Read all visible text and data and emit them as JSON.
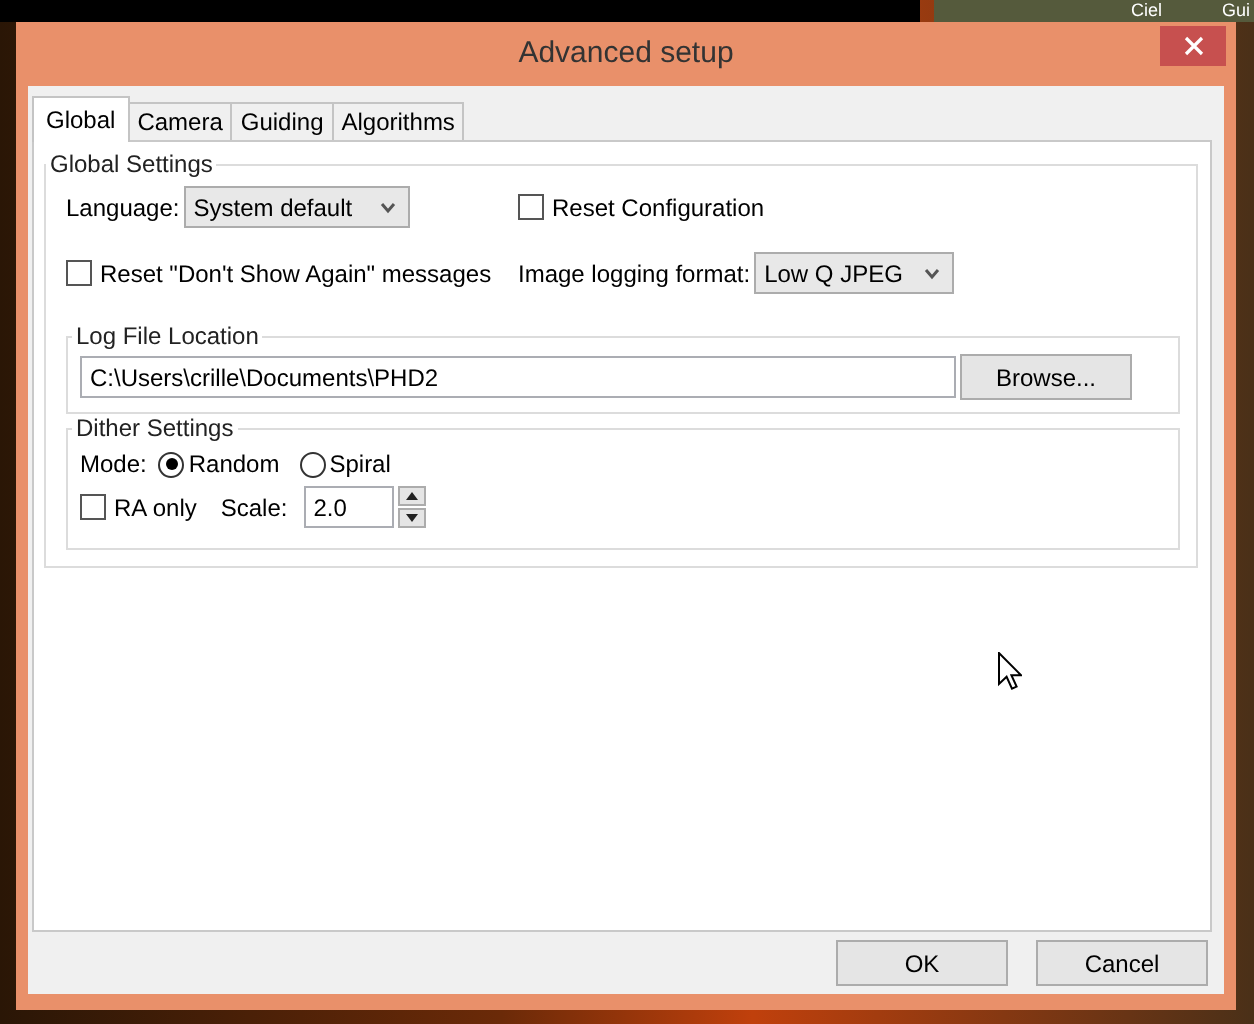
{
  "background": {
    "labels": [
      "Ciel",
      "Gui"
    ]
  },
  "window": {
    "title": "Advanced setup"
  },
  "tabs": [
    {
      "label": "Global",
      "selected": true
    },
    {
      "label": "Camera",
      "selected": false
    },
    {
      "label": "Guiding",
      "selected": false
    },
    {
      "label": "Algorithms",
      "selected": false
    }
  ],
  "global_settings": {
    "title": "Global Settings",
    "language": {
      "label": "Language:",
      "value": "System default"
    },
    "reset_configuration": {
      "label": "Reset Configuration",
      "checked": false
    },
    "reset_dont_show_again": {
      "label": "Reset \"Don't Show Again\" messages",
      "checked": false
    },
    "image_logging_format": {
      "label": "Image logging format:",
      "value": "Low Q JPEG"
    }
  },
  "log_file_location": {
    "title": "Log File Location",
    "path": "C:\\Users\\crille\\Documents\\PHD2",
    "browse_button": "Browse..."
  },
  "dither_settings": {
    "title": "Dither Settings",
    "mode_label": "Mode:",
    "modes": [
      {
        "label": "Random",
        "selected": true
      },
      {
        "label": "Spiral",
        "selected": false
      }
    ],
    "ra_only": {
      "label": "RA only",
      "checked": false
    },
    "scale": {
      "label": "Scale:",
      "value": "2.0"
    }
  },
  "buttons": [
    "OK",
    "Cancel"
  ]
}
